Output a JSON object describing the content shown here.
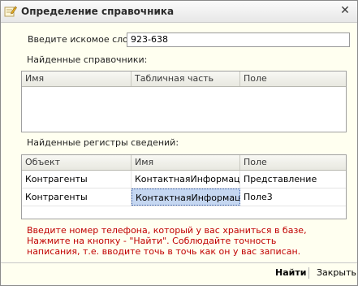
{
  "window": {
    "title": "Определение справочника"
  },
  "search": {
    "label": "Введите искомое слово:",
    "value": "923-638"
  },
  "catalogs": {
    "label": "Найденные справочники:",
    "columns": [
      "Имя",
      "Табличная часть",
      "Поле"
    ]
  },
  "registers": {
    "label": "Найденные регистры сведений:",
    "columns": [
      "Объект",
      "Имя",
      "Поле"
    ],
    "rows": [
      [
        "Контрагенты",
        "КонтактнаяИнформация",
        "Представление"
      ],
      [
        "Контрагенты",
        "КонтактнаяИнформация",
        "Поле3"
      ]
    ]
  },
  "hint": {
    "line1": "Введите номер телефона, который у вас храниться в базе,",
    "line2": "Нажмите на кнопку - \"Найти\". Соблюдайте точность",
    "line3": "написания, т.е.  вводите точь в точь как он у вас записан."
  },
  "buttons": {
    "find": "Найти",
    "close": "Закрыть"
  },
  "icons": {
    "title": "form-pencil-icon",
    "close": "close-icon"
  },
  "colors": {
    "hint": "#c00000",
    "selection": "#c5d7f1"
  }
}
